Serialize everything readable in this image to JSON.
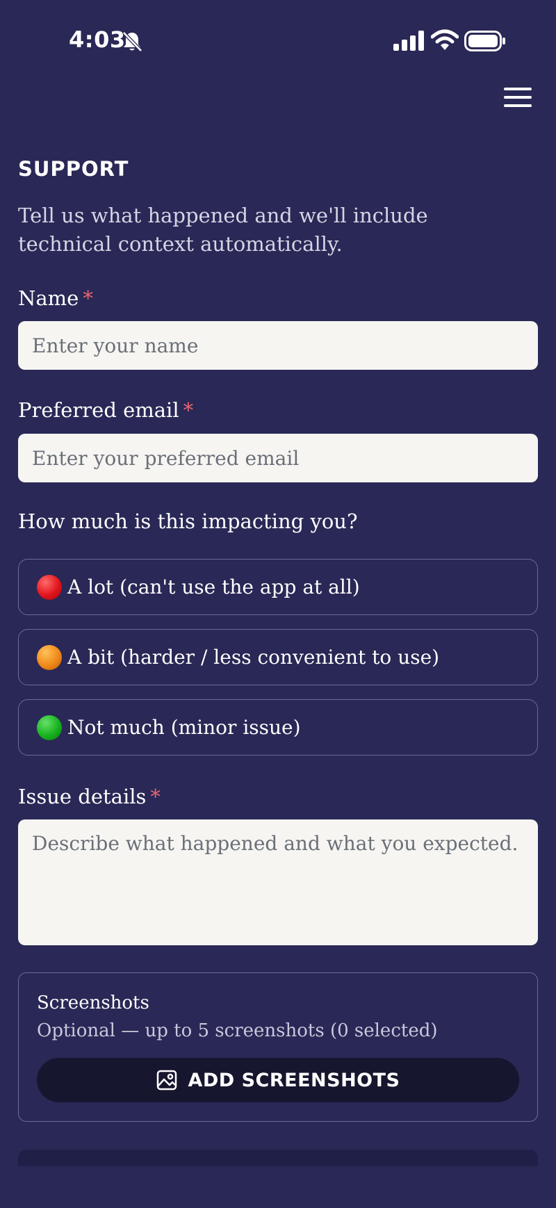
{
  "status_bar": {
    "time": "4:03",
    "icons": [
      "bell-slash-icon",
      "cellular-signal-icon",
      "wifi-icon",
      "battery-icon"
    ]
  },
  "header": {
    "menu_icon": "hamburger-menu-icon"
  },
  "page": {
    "title": "SUPPORT",
    "intro": "Tell us what happened and we'll include technical context automatically."
  },
  "form": {
    "name": {
      "label": "Name",
      "required_mark": "*",
      "placeholder": "Enter your name",
      "value": ""
    },
    "email": {
      "label": "Preferred email",
      "required_mark": "*",
      "placeholder": "Enter your preferred email",
      "value": ""
    },
    "impact": {
      "question": "How much is this impacting you?",
      "options": [
        {
          "label": "A lot (can't use the app at all)",
          "icon": "red-circle"
        },
        {
          "label": "A bit (harder / less convenient to use)",
          "icon": "orange-circle"
        },
        {
          "label": "Not much (minor issue)",
          "icon": "green-circle"
        }
      ]
    },
    "details": {
      "label": "Issue details",
      "required_mark": "*",
      "placeholder": "Describe what happened and what you expected.",
      "value": ""
    },
    "screenshots": {
      "title": "Screenshots",
      "subtitle": "Optional — up to 5 screenshots (0 selected)",
      "button_label": "ADD SCREENSHOTS",
      "button_icon": "image-icon"
    }
  },
  "colors": {
    "background": "#2a2856",
    "required": "#e8656f",
    "input_bg": "#f6f5f2",
    "button_bg": "#17162f"
  }
}
